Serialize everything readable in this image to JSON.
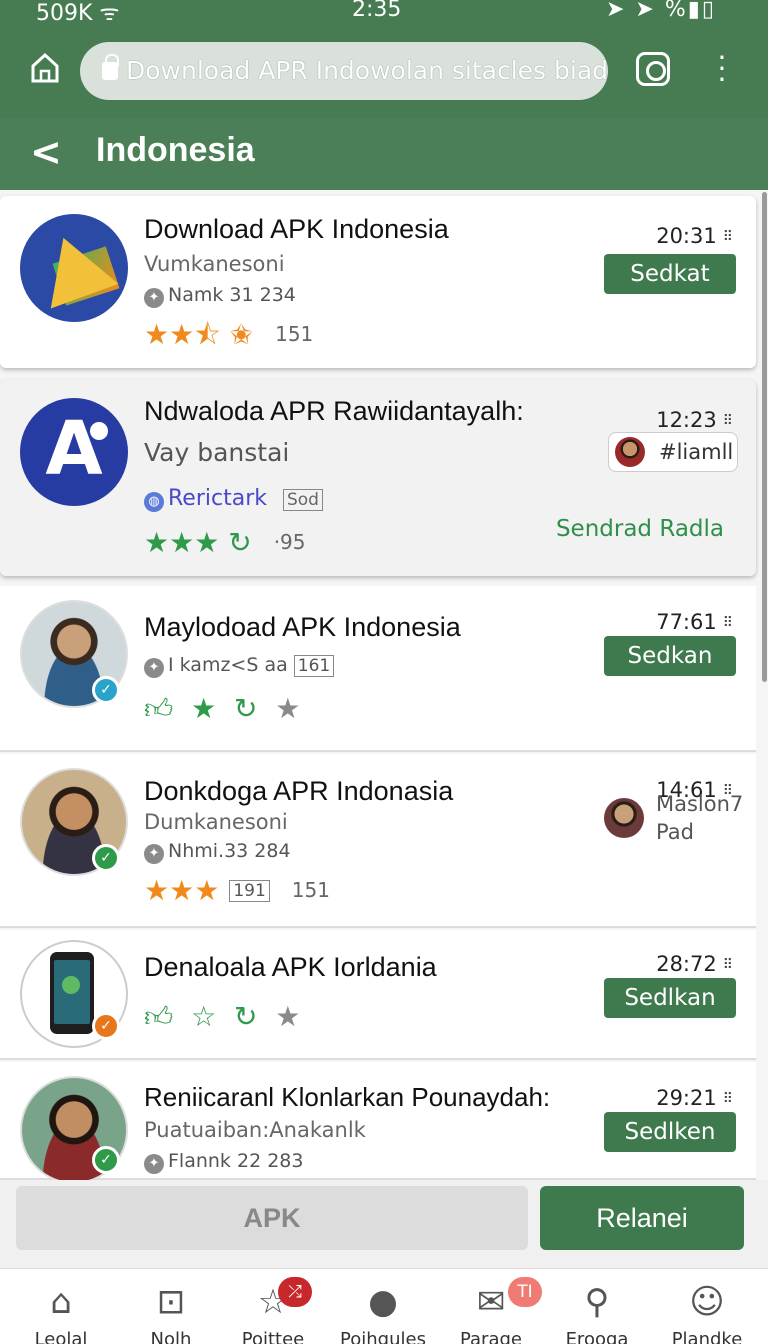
{
  "status": {
    "left": "509K",
    "time": "2:35",
    "right": "%"
  },
  "browser": {
    "url": "Download APR Indowolan sitacles biad"
  },
  "header": {
    "back": "<",
    "title": "Indonesia"
  },
  "items": [
    {
      "name": "Download APK Indonesia",
      "sub": "Vumkanesoni",
      "meta": "Namk 31 234",
      "rating_count": "151",
      "time": "20:31",
      "action": "Sedkat"
    },
    {
      "name": "Ndwaloda APR Rawiidantayalh:",
      "sub": "Vay banstai",
      "tag": "Rerictark",
      "tag_box": "Sod",
      "rating_count": "·95",
      "time": "12:23",
      "chip": "#liamll",
      "link": "Sendrad Radla"
    },
    {
      "name": "Maylodoad APK Indonesia",
      "meta": "I kamz<S aa",
      "meta_box": "161",
      "time": "77:61",
      "action": "Sedkan"
    },
    {
      "name": "Donkdoga APR Indonasia",
      "sub": "Dumkanesoni",
      "meta": "Nhmi.33 284",
      "meta_box": "191",
      "rating_count": "151",
      "time": "14:61",
      "side_1": "Maslon7",
      "side_2": "Pad"
    },
    {
      "name": "Denaloala APK Iorldania",
      "time": "28:72",
      "action": "Sedlkan"
    },
    {
      "name": "Reniicaranl Klonlarkan Pounaydah:",
      "sub": "Puatuaiban:Anakanlk",
      "meta": "Flannk 22 283",
      "time": "29:21",
      "action": "Sedlken"
    }
  ],
  "actions": {
    "apk": "APK",
    "primary": "Relanei"
  },
  "nav": [
    {
      "label": "Leolal",
      "icon": "home-icon"
    },
    {
      "label": "Nolh",
      "icon": "inbox-icon"
    },
    {
      "label": "Poittee",
      "icon": "star-icon",
      "badge": ""
    },
    {
      "label": "Poihgules",
      "icon": "people-icon"
    },
    {
      "label": "Parage",
      "icon": "mail-icon",
      "badge": "TI"
    },
    {
      "label": "Erooga",
      "icon": "search-icon"
    },
    {
      "label": "Plandke",
      "icon": "profile-icon"
    }
  ],
  "colors": {
    "primary": "#477c53",
    "accent_green": "#2f9a4a",
    "star_orange": "#f08a1d",
    "badge_red": "#c7282c",
    "badge_pink": "#f07a74"
  }
}
